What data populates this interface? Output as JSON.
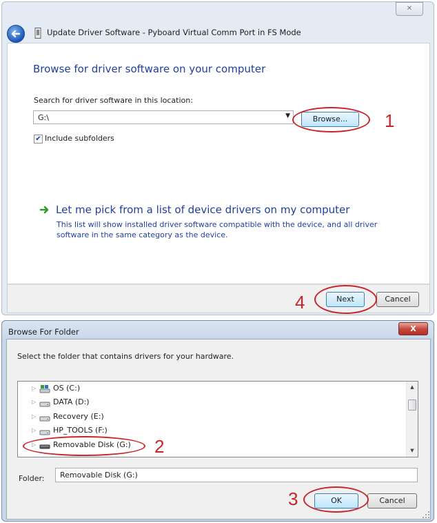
{
  "wizard": {
    "title": "Update Driver Software - Pyboard Virtual Comm Port in FS Mode",
    "close_glyph": "✕",
    "heading": "Browse for driver software on your computer",
    "search_label": "Search for driver software in this location:",
    "search_value": "G:\\",
    "browse_label": "Browse...",
    "include_subfolders_label": "Include subfolders",
    "include_subfolders_checked": true,
    "pick_link": "Let me pick from a list of device drivers on my computer",
    "pick_description": "This list will show installed driver software compatible with the device, and all driver software in the same category as the device.",
    "next_label": "Next",
    "cancel_label": "Cancel"
  },
  "browse_folder": {
    "title": "Browse For Folder",
    "close_glyph": "X",
    "instruction": "Select the folder that contains drivers for your hardware.",
    "tree": [
      {
        "label": "OS (C:)",
        "icon": "os-drive-icon"
      },
      {
        "label": "DATA (D:)",
        "icon": "drive-icon"
      },
      {
        "label": "Recovery (E:)",
        "icon": "drive-icon"
      },
      {
        "label": "HP_TOOLS (F:)",
        "icon": "drive-icon"
      },
      {
        "label": "Removable Disk (G:)",
        "icon": "removable-drive-icon",
        "selected": true
      }
    ],
    "folder_label": "Folder:",
    "folder_value": "Removable Disk (G:)",
    "ok_label": "OK",
    "cancel_label": "Cancel"
  },
  "annotations": {
    "step_1": "1",
    "step_2": "2",
    "step_3": "3",
    "step_4": "4",
    "color": "#c8252b"
  },
  "colors": {
    "link_blue": "#1f3f9f",
    "button_blue": "#bee6fd"
  }
}
